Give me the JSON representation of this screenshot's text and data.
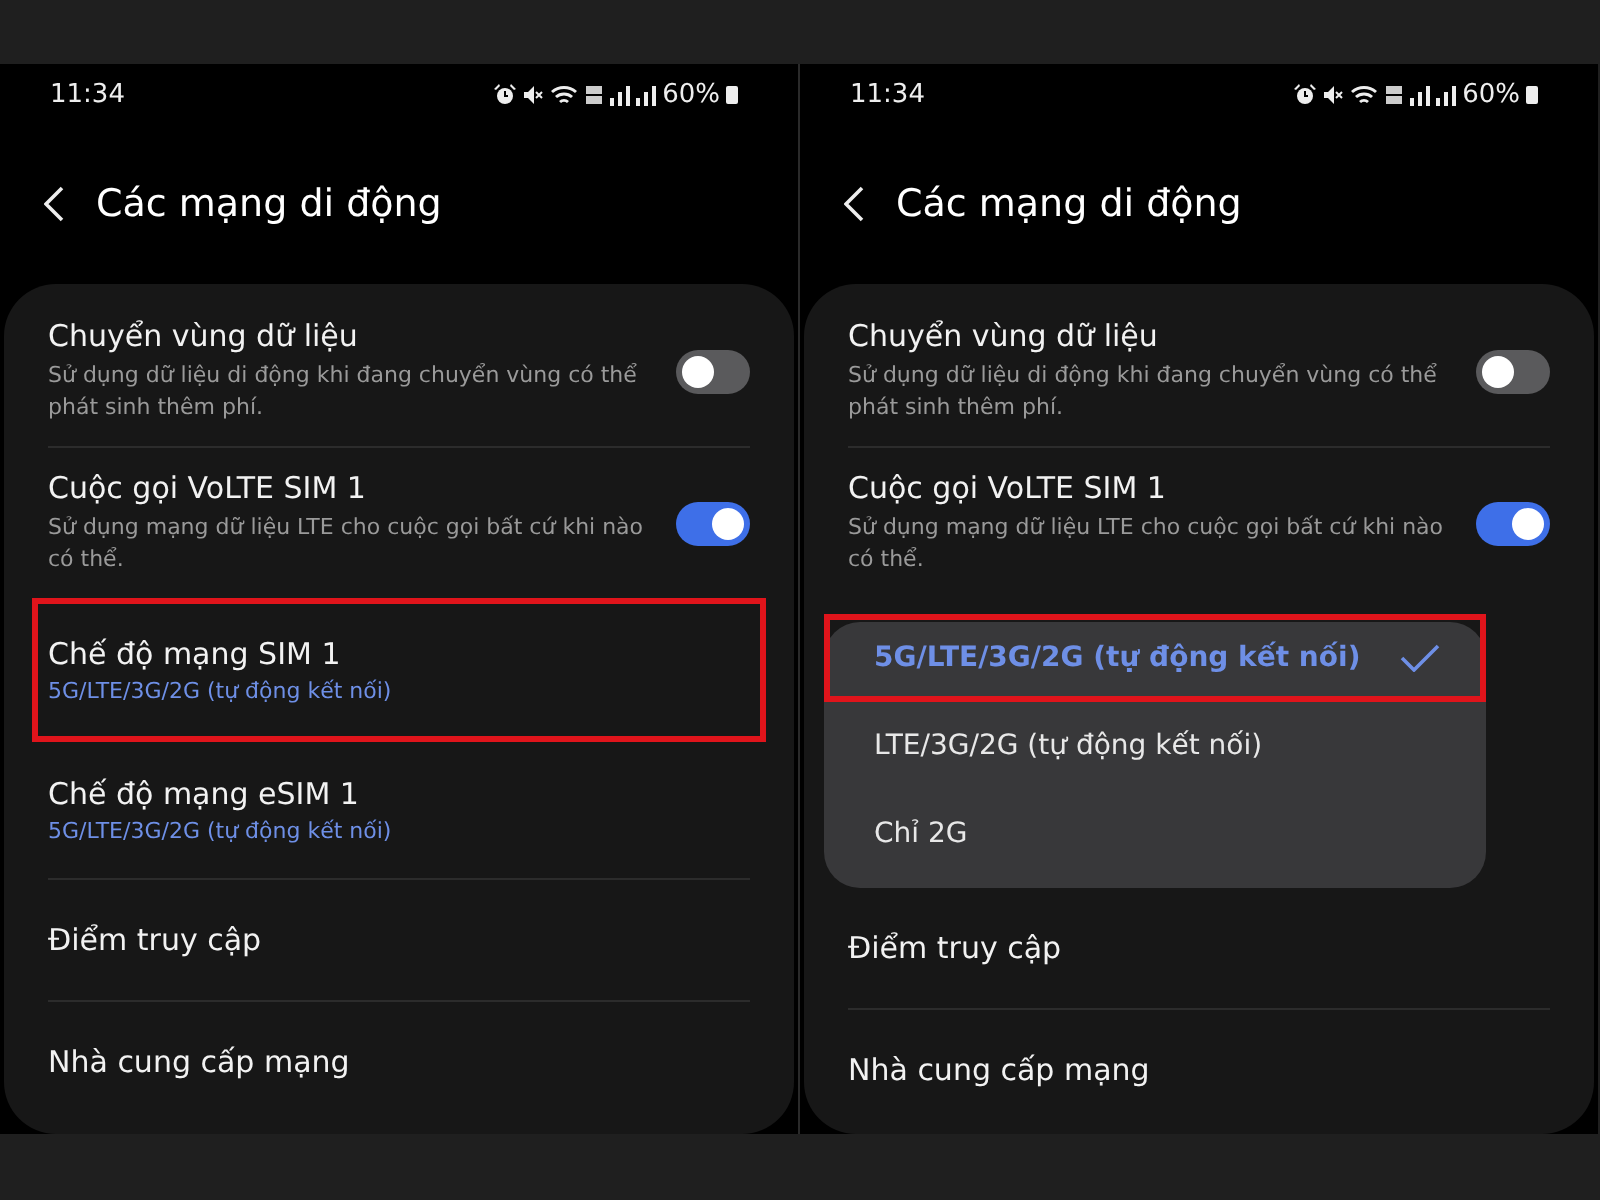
{
  "screens": [
    {
      "status": {
        "time": "11:34",
        "battery": "60%"
      },
      "title": "Các mạng di động",
      "items": [
        {
          "kind": "toggle",
          "title": "Chuyển vùng dữ liệu",
          "subtitle": "Sử dụng dữ liệu di động khi đang chuyển vùng có thể phát sinh thêm phí.",
          "on": false
        },
        {
          "kind": "toggle",
          "title": "Cuộc gọi VoLTE SIM 1",
          "subtitle": "Sử dụng mạng dữ liệu LTE cho cuộc gọi bất cứ khi nào có thể.",
          "on": true
        },
        {
          "kind": "value",
          "title": "Chế độ mạng SIM 1",
          "value": "5G/LTE/3G/2G (tự động kết nối)",
          "highlighted": true
        },
        {
          "kind": "value",
          "title": "Chế độ mạng eSIM 1",
          "value": "5G/LTE/3G/2G (tự động kết nối)",
          "highlighted": false
        },
        {
          "kind": "link",
          "title": "Điểm truy cập"
        },
        {
          "kind": "link",
          "title": "Nhà cung cấp mạng"
        }
      ]
    },
    {
      "status": {
        "time": "11:34",
        "battery": "60%"
      },
      "title": "Các mạng di động",
      "items": [
        {
          "kind": "toggle",
          "title": "Chuyển vùng dữ liệu",
          "subtitle": "Sử dụng dữ liệu di động khi đang chuyển vùng có thể phát sinh thêm phí.",
          "on": false
        },
        {
          "kind": "toggle",
          "title": "Cuộc gọi VoLTE SIM 1",
          "subtitle": "Sử dụng mạng dữ liệu LTE cho cuộc gọi bất cứ khi nào có thể.",
          "on": true
        },
        {
          "kind": "menu",
          "options": [
            {
              "label": "5G/LTE/3G/2G (tự động kết nối)",
              "selected": true,
              "highlighted": true
            },
            {
              "label": "LTE/3G/2G (tự động kết nối)",
              "selected": false,
              "highlighted": false
            },
            {
              "label": "Chỉ 2G",
              "selected": false,
              "highlighted": false
            }
          ]
        },
        {
          "kind": "link",
          "title": "Điểm truy cập"
        },
        {
          "kind": "link",
          "title": "Nhà cung cấp mạng"
        }
      ]
    }
  ]
}
